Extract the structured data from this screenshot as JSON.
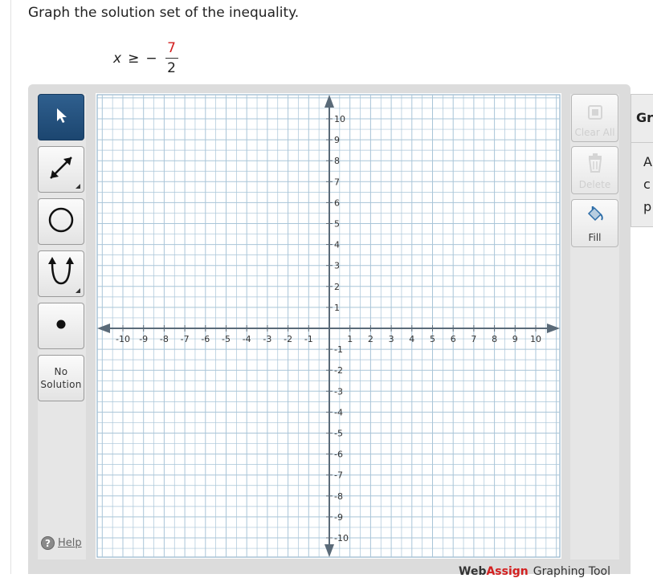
{
  "question": {
    "text": "Graph the solution set of the inequality."
  },
  "inequality": {
    "variable": "x",
    "relation": "≥",
    "sign": "−",
    "numerator": "7",
    "denominator": "2"
  },
  "tools": {
    "select": {
      "icon": "cursor-arrow-icon"
    },
    "line": {
      "icon": "line-arrow-icon"
    },
    "circle": {
      "icon": "circle-icon"
    },
    "parabola": {
      "icon": "parabola-icon"
    },
    "point": {
      "icon": "point-icon"
    },
    "no_solution": {
      "line1": "No",
      "line2": "Solution"
    },
    "help_label": "Help",
    "help_glyph": "?"
  },
  "actions": {
    "clear_all": {
      "label": "Clear All",
      "icon": "clear-all-icon"
    },
    "delete": {
      "label": "Delete",
      "icon": "trash-icon"
    },
    "fill": {
      "label": "Fill",
      "icon": "fill-bucket-icon"
    }
  },
  "side_panel": {
    "heading": "Gr",
    "lines": [
      "A",
      "c",
      "p"
    ]
  },
  "brand": {
    "part1": "Web",
    "part2": "Assign",
    "part3": "Graphing Tool"
  },
  "graph": {
    "x_ticks": [
      "-10",
      "-9",
      "-8",
      "-7",
      "-6",
      "-5",
      "-4",
      "-3",
      "-2",
      "-1",
      "1",
      "2",
      "3",
      "4",
      "5",
      "6",
      "7",
      "8",
      "9",
      "10"
    ],
    "y_ticks": [
      "10",
      "9",
      "8",
      "7",
      "6",
      "5",
      "4",
      "3",
      "2",
      "1",
      "-1",
      "-2",
      "-3",
      "-4",
      "-5",
      "-6",
      "-7",
      "-8",
      "-9",
      "-10"
    ],
    "x_range": [
      -10,
      10
    ],
    "y_range": [
      -10,
      10
    ],
    "colors": {
      "grid": "#a9c5d8",
      "axis": "#5a6a78",
      "accent": "#d32020",
      "active_tool": "#1f4a75"
    }
  }
}
